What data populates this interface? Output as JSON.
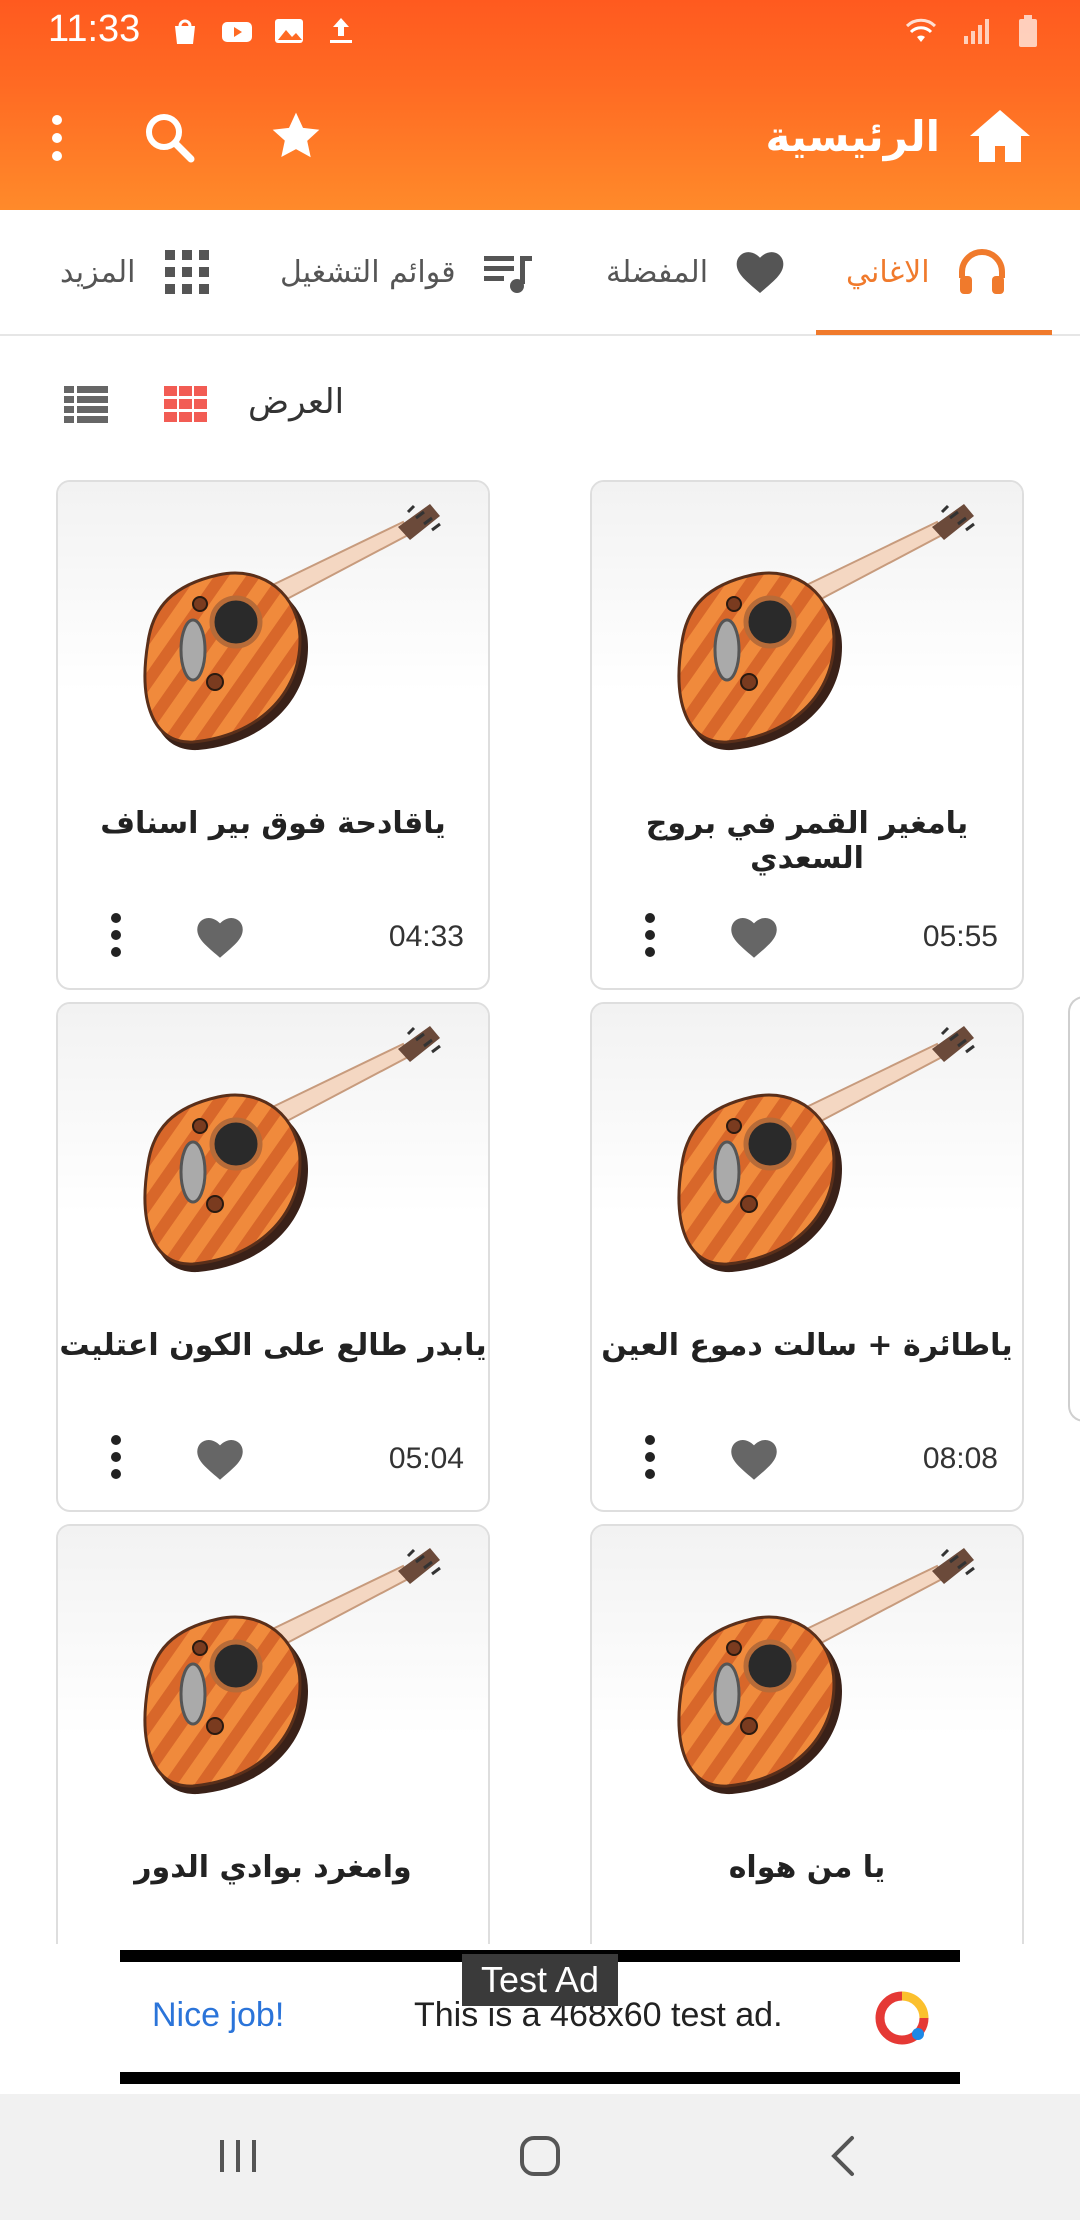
{
  "status_bar": {
    "time": "11:33"
  },
  "app_bar": {
    "title": "الرئيسية"
  },
  "tabs": [
    {
      "label": "الاغاني",
      "active": true
    },
    {
      "label": "المفضلة",
      "active": false
    },
    {
      "label": "قوائم التشغيل",
      "active": false
    },
    {
      "label": "المزيد",
      "active": false
    }
  ],
  "view": {
    "label": "العرض"
  },
  "songs": [
    {
      "title": "يامغير القمر في بروج السعدي",
      "duration": "05:55"
    },
    {
      "title": "ياقادحة فوق بير اسناف",
      "duration": "04:33"
    },
    {
      "title": "ياطائرة + سالت دموع العين",
      "duration": "08:08"
    },
    {
      "title": "يابدر طالع على الكون اعتليت",
      "duration": "05:04"
    },
    {
      "title": "يا من هواه",
      "duration": ""
    },
    {
      "title": "وامغرد بوادي الدور",
      "duration": ""
    }
  ],
  "ad": {
    "label": "Test Ad",
    "cta": "Nice job!",
    "text": "This is a 468x60 test ad."
  },
  "colors": {
    "accent": "#f07a2c",
    "appbar_top": "#ff5a1f",
    "appbar_bottom": "#ff8a2a"
  }
}
